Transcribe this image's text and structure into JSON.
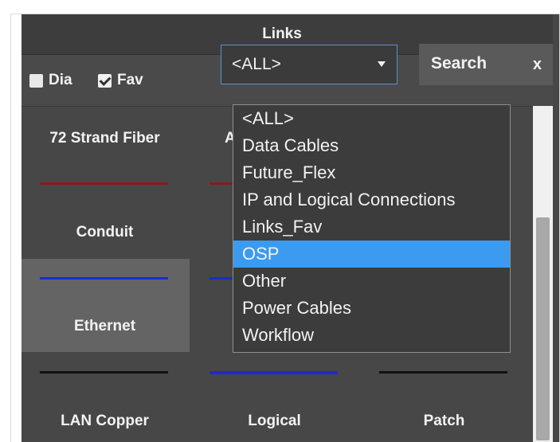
{
  "window": {
    "title": "Links"
  },
  "filters": {
    "dia": {
      "label": "Dia",
      "checked": false
    },
    "fav": {
      "label": "Fav",
      "checked": true
    }
  },
  "category_select": {
    "value": "<ALL>",
    "options": [
      "<ALL>",
      "Data Cables",
      "Future_Flex",
      "IP and Logical Connections",
      "Links_Fav",
      "OSP",
      "Other",
      "Power Cables",
      "Workflow"
    ],
    "highlighted": "OSP"
  },
  "search": {
    "label": "Search",
    "clear": "x"
  },
  "link_types": [
    {
      "label": "72 Strand Fiber",
      "color": "#8b1a1a"
    },
    {
      "label": "A",
      "color": "#8b1a1a"
    },
    {
      "label": "Conduit",
      "color": "#1a2ccf"
    },
    {
      "label": "Ethernet",
      "color": "#1a2ccf",
      "selected": true
    },
    {
      "label": "LAN Copper",
      "color": "#111111"
    },
    {
      "label": "Logical",
      "color": "#1a2ccf"
    },
    {
      "label": "Patch",
      "color": "#111111"
    }
  ],
  "colors": {
    "accent": "#3a9bf0",
    "panel": "#474747"
  }
}
